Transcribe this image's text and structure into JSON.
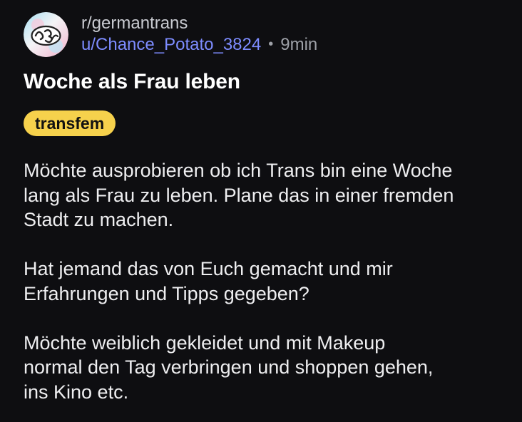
{
  "post": {
    "subreddit": "r/germantrans",
    "username": "u/Chance_Potato_3824",
    "separator": "•",
    "time": "9min",
    "title": "Woche als Frau leben",
    "flair": "transfem",
    "paragraphs": [
      "Möchte ausprobieren ob ich Trans bin eine Woche\nlang als Frau zu leben. Plane das in einer fremden\nStadt zu machen.",
      "Hat jemand das von Euch gemacht und mir\nErfahrungen und Tipps gegeben?",
      "Möchte weiblich gekleidet und mit Makeup\nnormal den Tag verbringen und shoppen gehen,\nins Kino etc."
    ]
  },
  "icons": {
    "avatar": "subreddit-avatar-icon"
  },
  "colors": {
    "background": "#0e0e11",
    "username": "#7d8cff",
    "flair_bg": "#f6d14c",
    "text": "#eeeef0"
  }
}
